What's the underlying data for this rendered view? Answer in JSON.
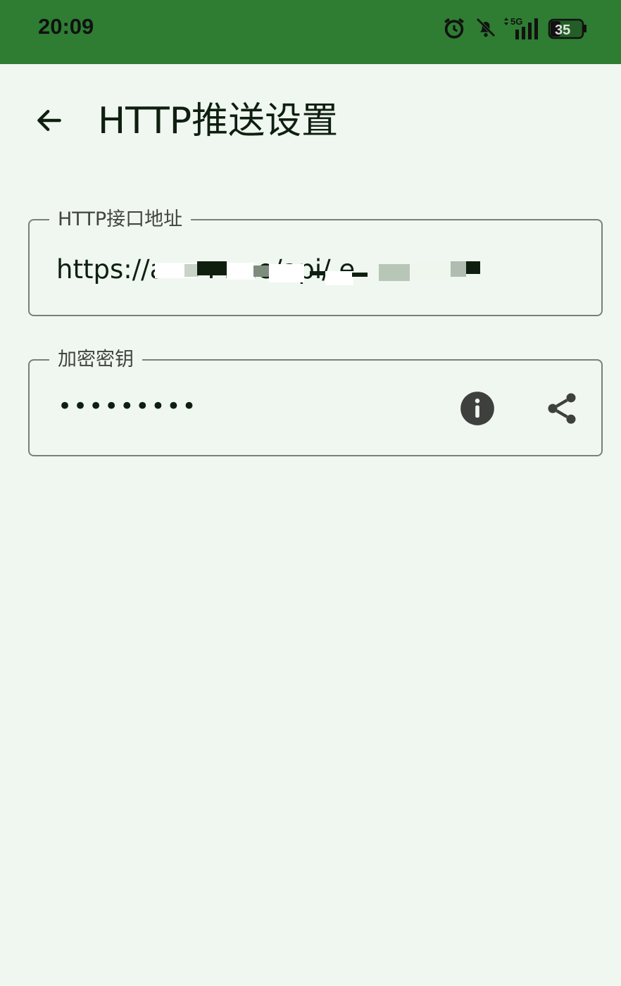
{
  "status_bar": {
    "time": "20:09",
    "network": "5G",
    "battery": "35",
    "icons": [
      "alarm-icon",
      "bell-off-icon",
      "signal-5g-icon",
      "battery-icon"
    ]
  },
  "app_bar": {
    "title": "HTTP推送设置",
    "back_icon": "arrow-back-icon"
  },
  "form": {
    "url_field": {
      "label": "HTTP接口地址",
      "value": "https://a    .  .   .  .me/api/           e"
    },
    "key_field": {
      "label": "加密密钥",
      "masked_value": "•••••••••",
      "info_icon": "info-icon",
      "share_icon": "share-icon"
    }
  },
  "colors": {
    "status_bar": "#2e7d32",
    "background": "#f0f6f0",
    "text": "#0e1f0f",
    "outline": "#7b7f7b"
  }
}
